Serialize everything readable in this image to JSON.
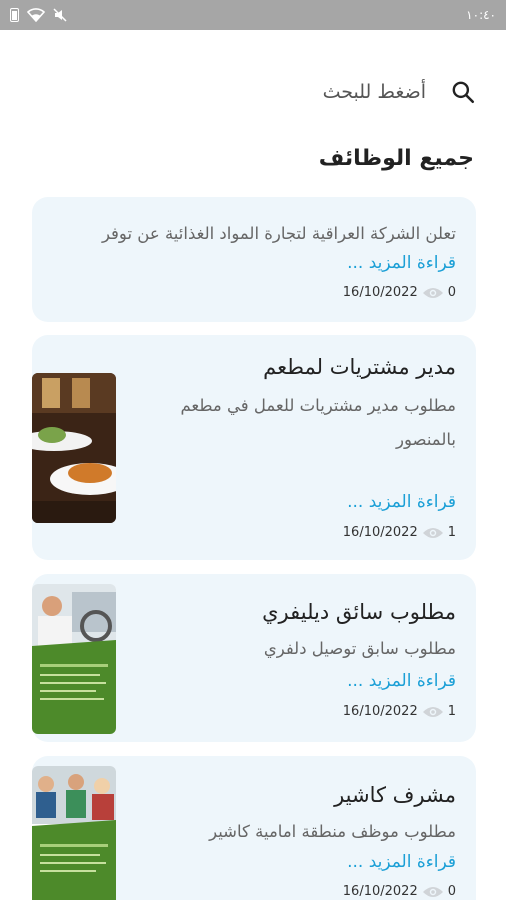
{
  "status_bar": {
    "time": "١٠:٤٠"
  },
  "search": {
    "placeholder_text": "أضغط للبحث"
  },
  "section_title": "جميع الوظائف",
  "jobs": [
    {
      "title": "",
      "description": "تعلن الشركة العراقية لتجارة المواد الغذائية عن توفر",
      "read_more": "قراءة المزيد ...",
      "date": "16/10/2022",
      "views": "0"
    },
    {
      "title": "مدير مشتريات لمطعم",
      "description": "مطلوب مدير مشتريات للعمل في مطعم بالمنصور",
      "read_more": "قراءة المزيد ...",
      "date": "16/10/2022",
      "views": "1"
    },
    {
      "title": "مطلوب سائق ديليفري",
      "description": "مطلوب سابق توصيل دلفري",
      "read_more": "قراءة المزيد ...",
      "date": "16/10/2022",
      "views": "1"
    },
    {
      "title": "مشرف كاشير",
      "description": "مطلوب موظف منطقة امامية كاشير",
      "read_more": "قراءة المزيد ...",
      "date": "16/10/2022",
      "views": "0"
    }
  ],
  "colors": {
    "status_bar": "#a6a6a6",
    "card_background": "#eef6fb",
    "link": "#1a9fd6"
  }
}
